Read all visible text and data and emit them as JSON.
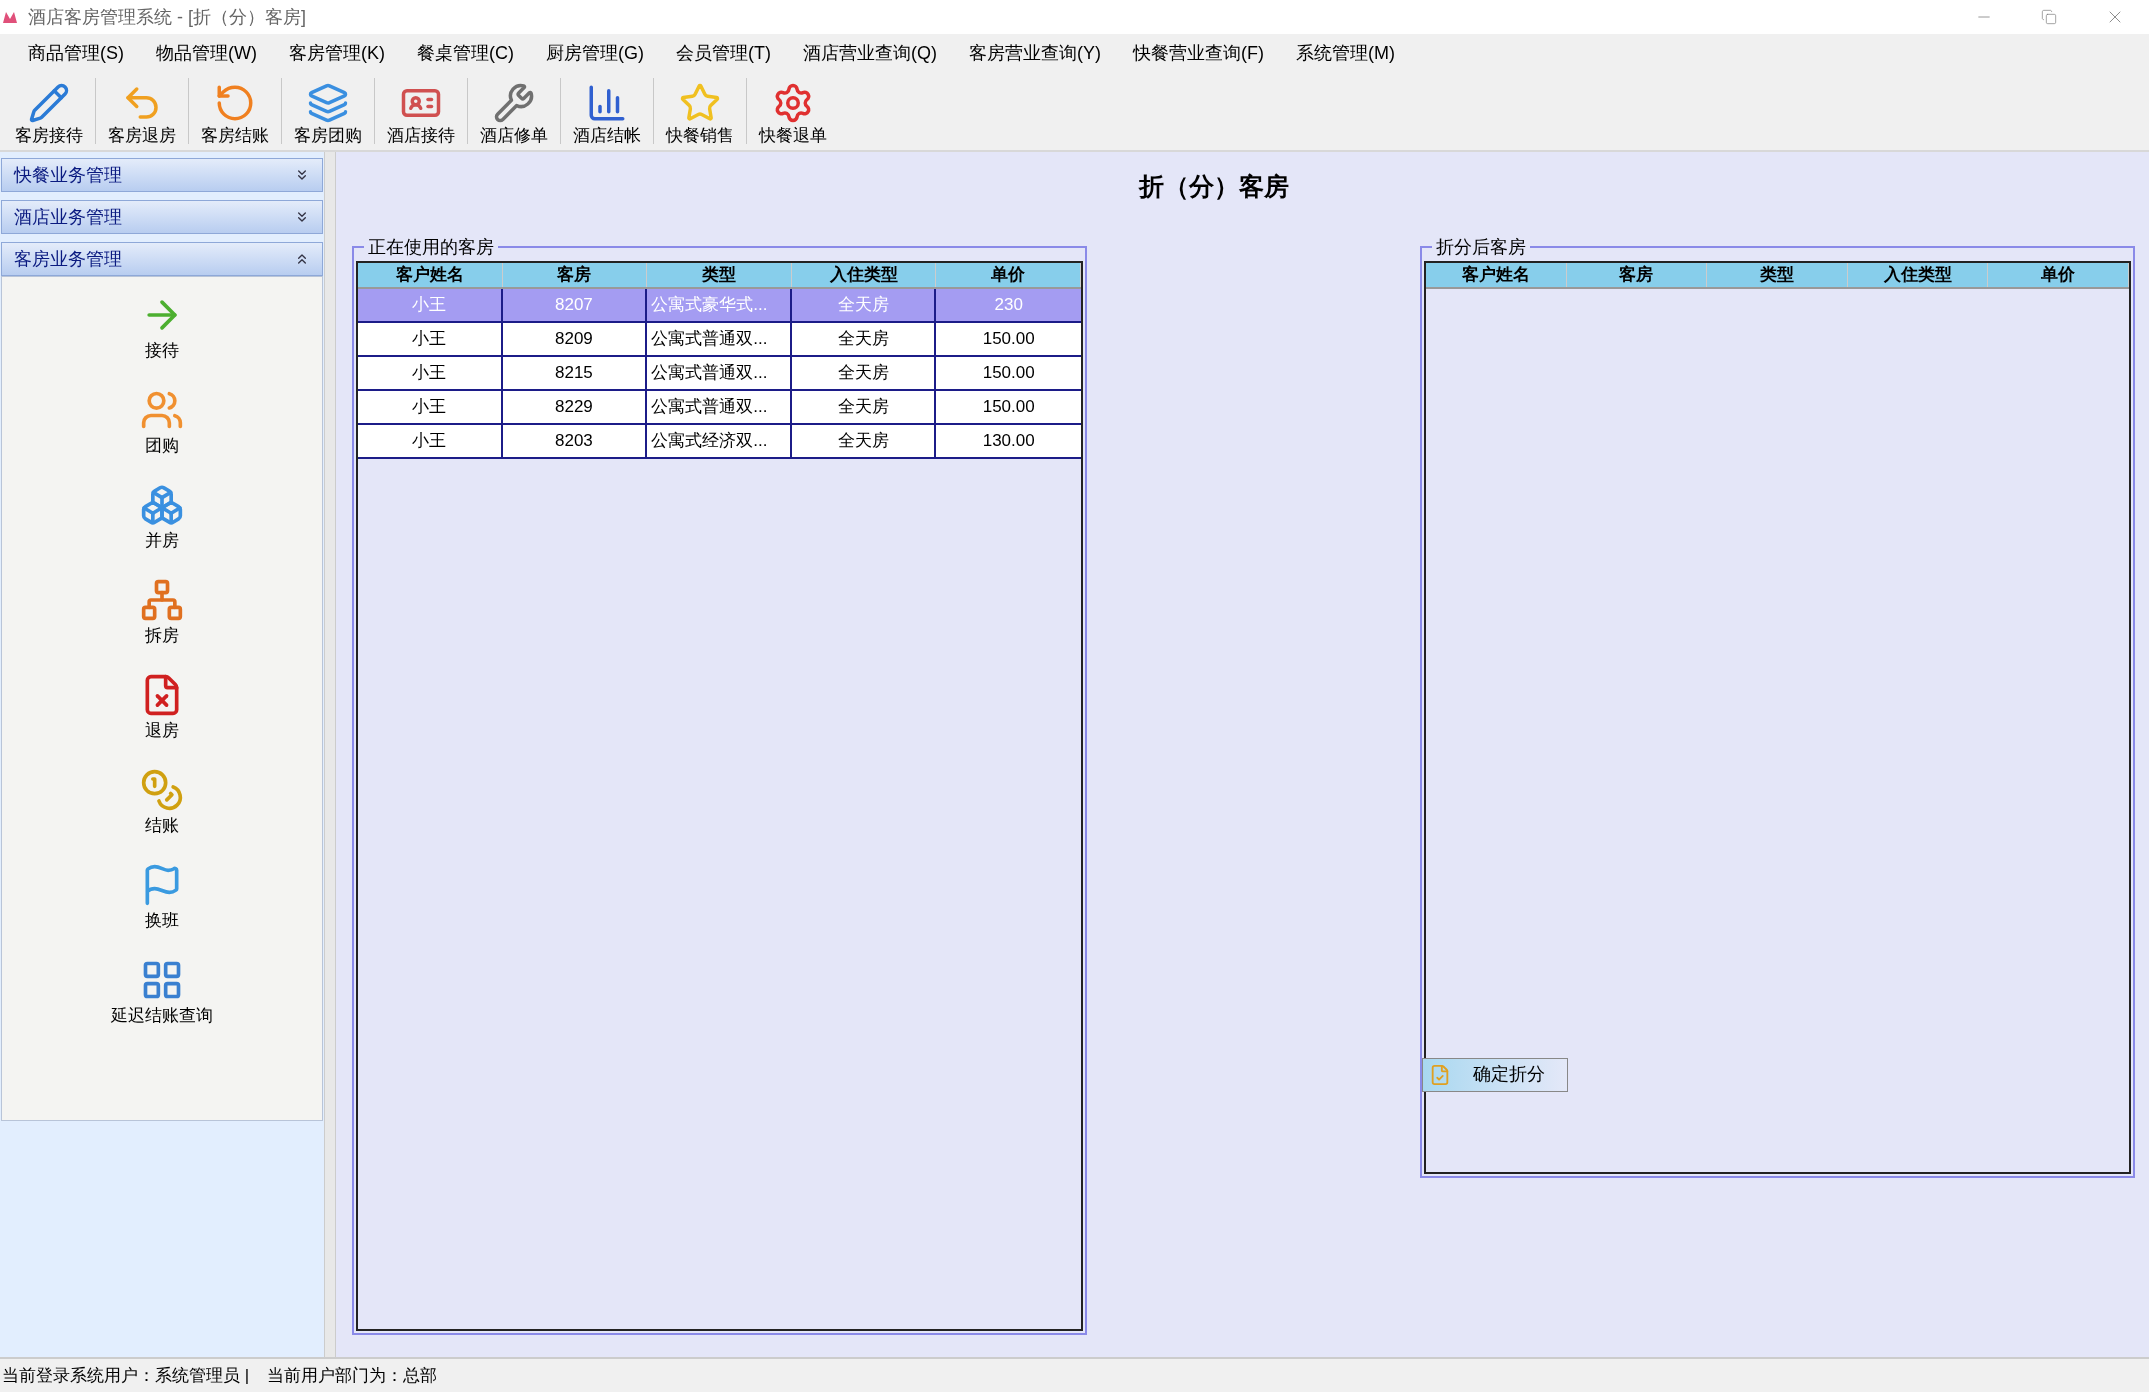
{
  "window": {
    "title": "酒店客房管理系统 - [折（分）客房]"
  },
  "menu": [
    "商品管理(S)",
    "物品管理(W)",
    "客房管理(K)",
    "餐桌管理(C)",
    "厨房管理(G)",
    "会员管理(T)",
    "酒店营业查询(Q)",
    "客房营业查询(Y)",
    "快餐营业查询(F)",
    "系统管理(M)"
  ],
  "toolbar": [
    "客房接待",
    "客房退房",
    "客房结账",
    "客房团购",
    "酒店接待",
    "酒店修单",
    "酒店结帐",
    "快餐销售",
    "快餐退单"
  ],
  "sidebar": [
    {
      "label": "快餐业务管理",
      "expanded": false
    },
    {
      "label": "酒店业务管理",
      "expanded": false
    },
    {
      "label": "客房业务管理",
      "expanded": true,
      "items": [
        "接待",
        "团购",
        "并房",
        "拆房",
        "退房",
        "结账",
        "换班",
        "延迟结账查询"
      ]
    }
  ],
  "page_title": "折（分）客房",
  "left_panel": {
    "title": "正在使用的客房",
    "columns": [
      "客户姓名",
      "客房",
      "类型",
      "入住类型",
      "单价"
    ],
    "rows": [
      {
        "cells": [
          "小王",
          "8207",
          "公寓式豪华式...",
          "全天房",
          "230"
        ],
        "selected": true
      },
      {
        "cells": [
          "小王",
          "8209",
          "公寓式普通双...",
          "全天房",
          "150.00"
        ],
        "selected": false
      },
      {
        "cells": [
          "小王",
          "8215",
          "公寓式普通双...",
          "全天房",
          "150.00"
        ],
        "selected": false
      },
      {
        "cells": [
          "小王",
          "8229",
          "公寓式普通双...",
          "全天房",
          "150.00"
        ],
        "selected": false
      },
      {
        "cells": [
          "小王",
          "8203",
          "公寓式经济双...",
          "全天房",
          "130.00"
        ],
        "selected": false
      }
    ]
  },
  "right_panel": {
    "title": "折分后客房",
    "columns": [
      "客户姓名",
      "客房",
      "类型",
      "入住类型",
      "单价"
    ],
    "button": "确定折分"
  },
  "status_bar": [
    "当前登录系统用户：系统管理员 |",
    "当前用户部门为：总部"
  ]
}
